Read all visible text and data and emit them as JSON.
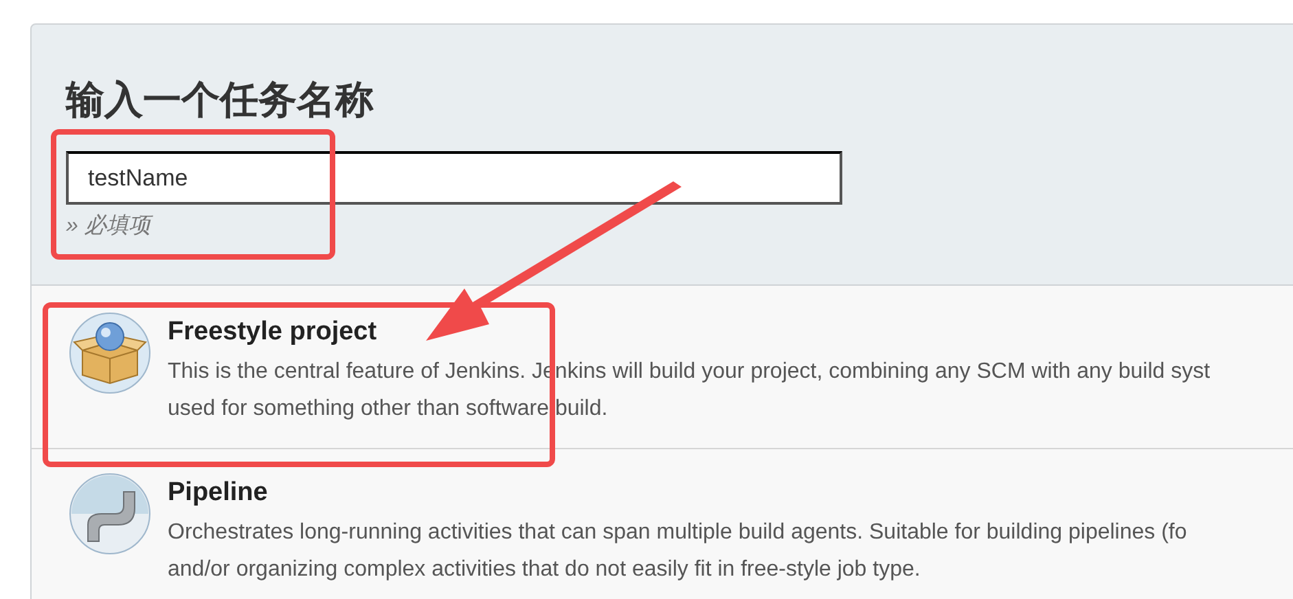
{
  "heading": "输入一个任务名称",
  "name_field": {
    "value": "testName"
  },
  "required_hint": "» 必填项",
  "job_types": [
    {
      "kind": "freestyle",
      "title": "Freestyle project",
      "description_lines": [
        "This is the central feature of Jenkins. Jenkins will build your project, combining any SCM with any build syst",
        "used for something other than software build."
      ]
    },
    {
      "kind": "pipeline",
      "title": "Pipeline",
      "description_lines": [
        "Orchestrates long-running activities that can span multiple build agents. Suitable for building pipelines (fo",
        "and/or organizing complex activities that do not easily fit in free-style job type."
      ]
    }
  ],
  "annotations": [
    {
      "kind": "box"
    },
    {
      "kind": "box"
    },
    {
      "kind": "arrow"
    }
  ]
}
